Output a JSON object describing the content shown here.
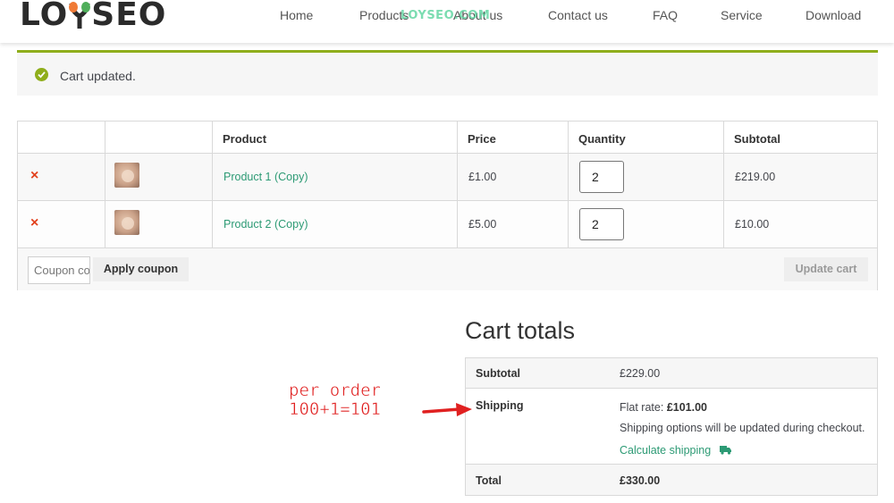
{
  "brand": {
    "logo_left": "LO",
    "logo_right": "SEO",
    "watermark": "LOYSEO.COM"
  },
  "nav": {
    "items": [
      "Home",
      "Products",
      "About us",
      "Contact us",
      "FAQ",
      "Service",
      "Download"
    ]
  },
  "notice": {
    "text": "Cart updated.",
    "icon": "check-circle-icon",
    "color": "#8fae1b"
  },
  "cart": {
    "headers": {
      "product": "Product",
      "price": "Price",
      "quantity": "Quantity",
      "subtotal": "Subtotal"
    },
    "rows": [
      {
        "remove": "×",
        "name": "Product 1 (Copy)",
        "price": "£1.00",
        "quantity": "2",
        "subtotal": "£219.00"
      },
      {
        "remove": "×",
        "name": "Product 2 (Copy)",
        "price": "£5.00",
        "quantity": "2",
        "subtotal": "£10.00"
      }
    ],
    "coupon_placeholder": "Coupon code",
    "apply_coupon": "Apply coupon",
    "update_cart": "Update cart"
  },
  "totals": {
    "title": "Cart totals",
    "subtotal_label": "Subtotal",
    "subtotal_value": "£229.00",
    "shipping_label": "Shipping",
    "flat_rate_label": "Flat rate:",
    "flat_rate_value": "£101.00",
    "shipping_note": "Shipping options will be updated during checkout.",
    "calculate_shipping": "Calculate shipping",
    "total_label": "Total",
    "total_value": "£330.00"
  },
  "annotation": {
    "line1": "per order",
    "line2": "100+1=101"
  },
  "colors": {
    "link": "#2c9a74",
    "remove": "#e2401c",
    "accent": "#8fae1b",
    "annotation": "#e02020"
  }
}
